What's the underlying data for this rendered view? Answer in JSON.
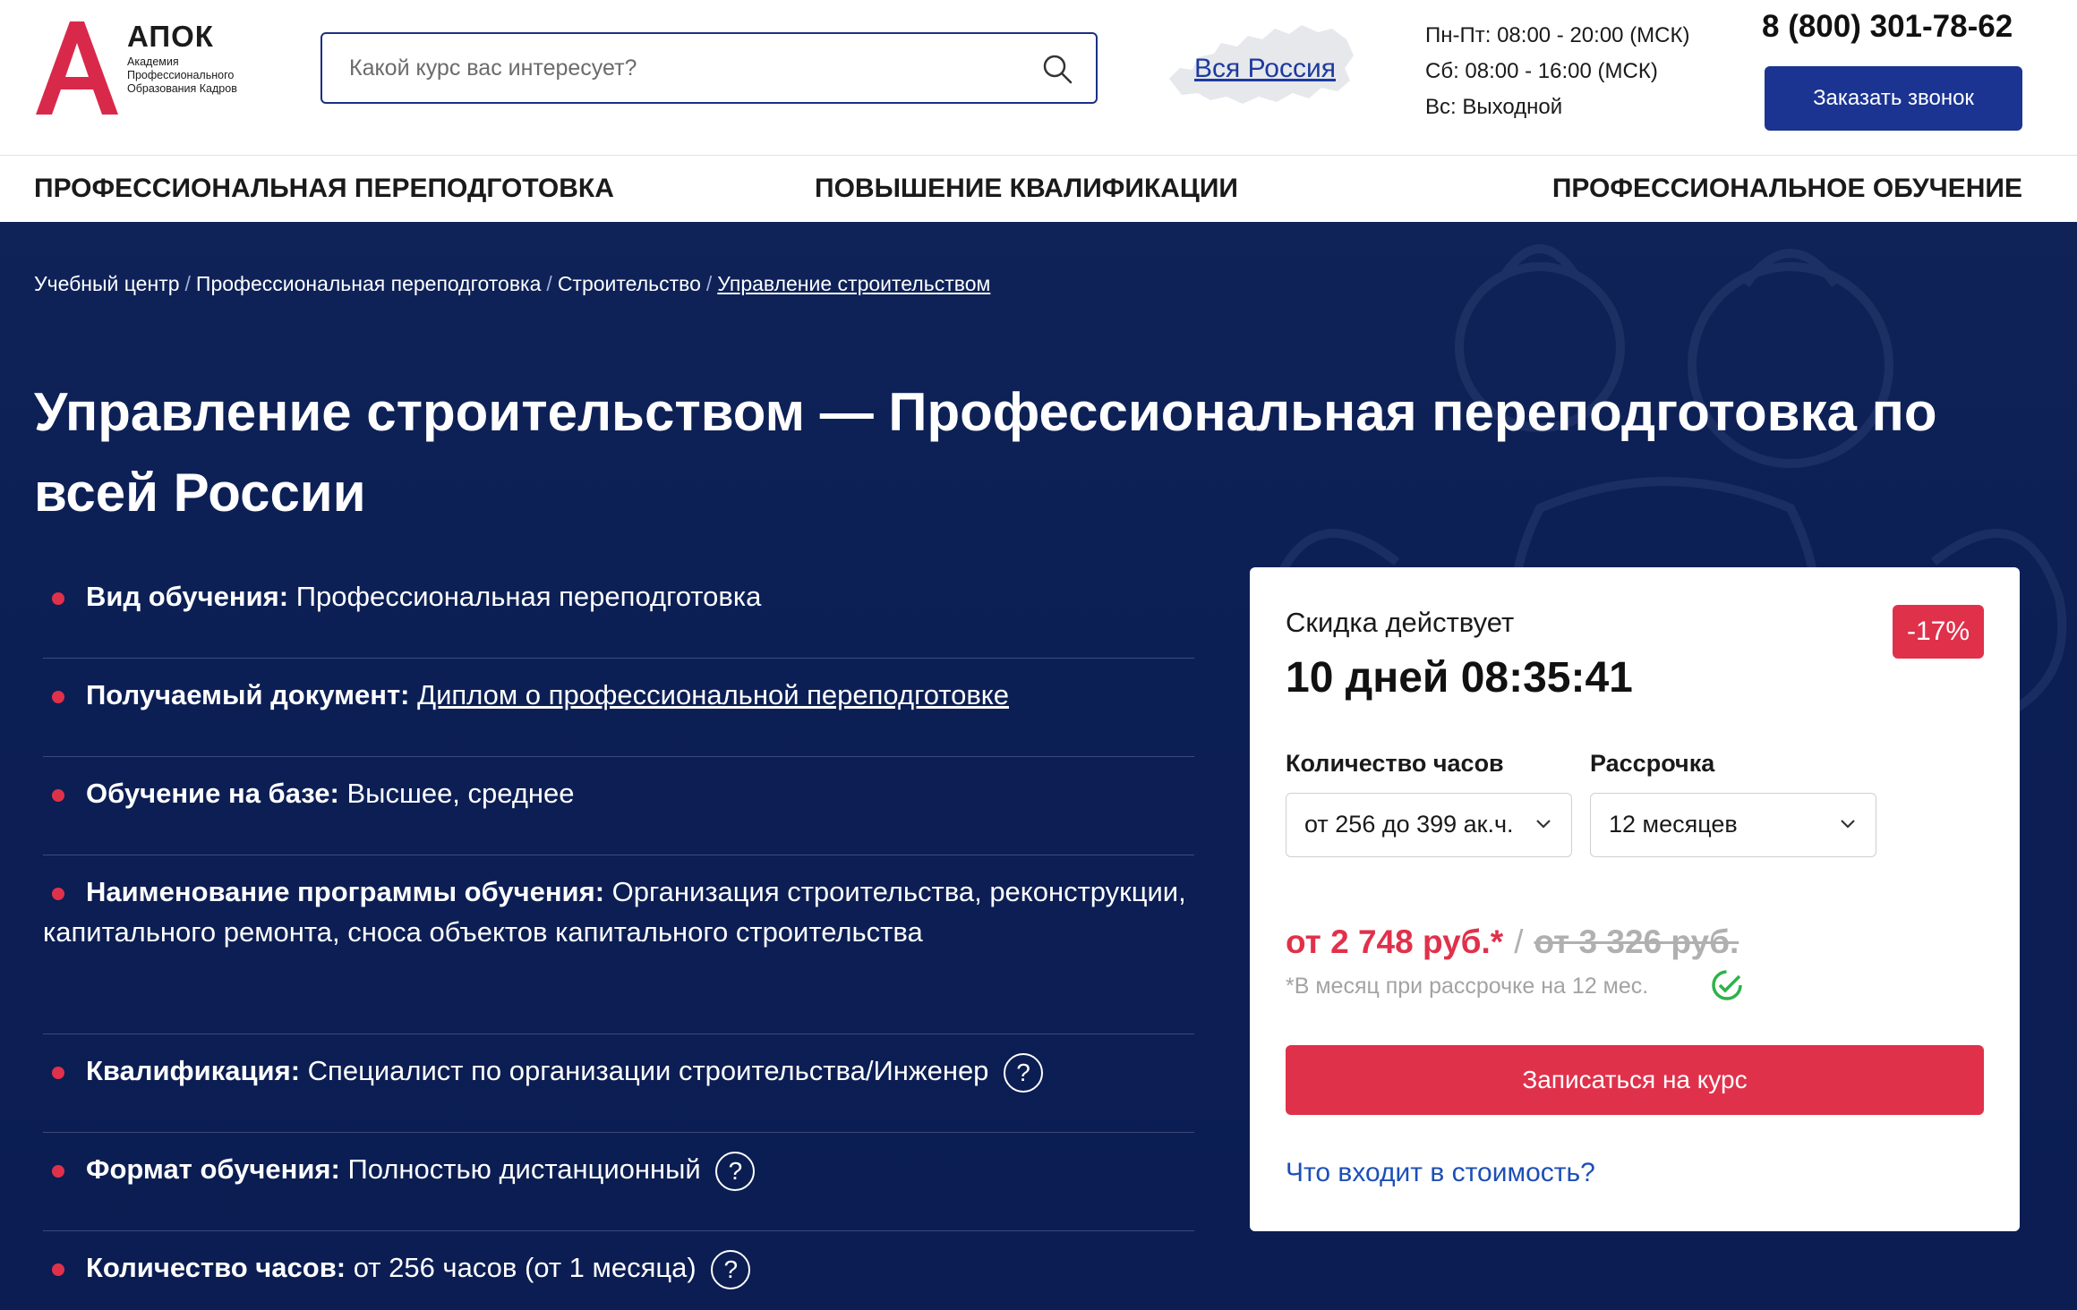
{
  "header": {
    "logo": {
      "name": "АПОК",
      "subtitle": "Академия Профессионального Образования Кадров"
    },
    "search": {
      "placeholder": "Какой курс вас интересует?",
      "value": ""
    },
    "region": {
      "label": "Вся Россия"
    },
    "hours": [
      "Пн-Пт: 08:00 - 20:00 (МСК)",
      "Сб: 08:00 - 16:00 (МСК)",
      "Вс: Выходной"
    ],
    "phone": "8 (800) 301-78-62",
    "callback_label": "Заказать звонок"
  },
  "nav": {
    "items": [
      "ПРОФЕССИОНАЛЬНАЯ ПЕРЕПОДГОТОВКА",
      "ПОВЫШЕНИЕ КВАЛИФИКАЦИИ",
      "ПРОФЕССИОНАЛЬНОЕ ОБУЧЕНИЕ"
    ]
  },
  "breadcrumb": [
    "Учебный центр",
    "Профессиональная переподготовка",
    "Строительство",
    "Управление строительством"
  ],
  "page_title": "Управление строительством — Профессиональная переподготовка по всей России",
  "properties": [
    {
      "label": "Вид обучения:",
      "value": "Профессиональная переподготовка"
    },
    {
      "label": "Получаемый документ:",
      "value": "Диплом о профессиональной переподготовке"
    },
    {
      "label": "Обучение на базе:",
      "value": "Высшее, среднее"
    },
    {
      "label": "Наименование программы обучения:",
      "value": "Организация строительства, реконструкции, капитального ремонта, сноса объектов капитального строительства"
    },
    {
      "label": "Квалификация:",
      "value": "Специалист по организации строительства/Инженер"
    },
    {
      "label": "Формат обучения:",
      "value": "Полностью дистанционный"
    },
    {
      "label": "Количество часов:",
      "value": "от 256 часов (от 1 месяца)"
    }
  ],
  "help_glyph": "?",
  "price_card": {
    "discount_label": "Скидка действует",
    "timer": "10 дней 08:35:41",
    "discount_badge": "-17%",
    "hours_label": "Количество часов",
    "hours_value": "от 256 до 399 ак.ч.",
    "installment_label": "Рассрочка",
    "installment_value": "12 месяцев",
    "price_new": "от 2 748 руб.*",
    "price_separator": "/",
    "price_old": "от 3 326 руб.",
    "note": "*В месяц при рассрочке на 12 мес.",
    "enroll_label": "Записаться на курс",
    "cost_link": "Что входит в стоимость?"
  },
  "colors": {
    "brand_blue": "#1b3492",
    "accent_red": "#e0314b",
    "hero_bg": "#0c1f55",
    "link_blue": "#1d4fb8"
  }
}
